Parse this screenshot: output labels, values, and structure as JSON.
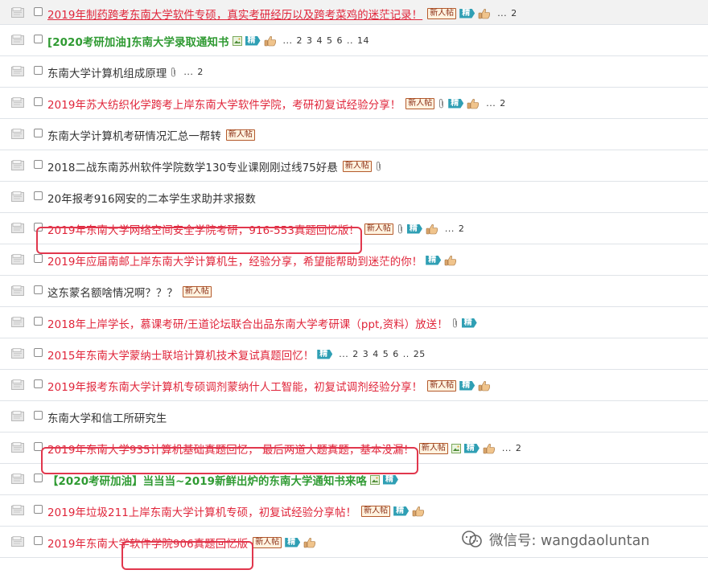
{
  "threads": [
    {
      "title": "2019年制药跨考东南大学软件专硕，真实考研经历以及跨考菜鸡的迷茫记录！",
      "style": "red-ul",
      "badges": [
        "new",
        "jing",
        "thumb"
      ],
      "pages": [
        "...",
        "2"
      ]
    },
    {
      "title": "[2020考研加油]东南大学录取通知书",
      "style": "green",
      "badges": [
        "img",
        "jing",
        "thumb"
      ],
      "pages": [
        "...",
        "2",
        "3",
        "4",
        "5",
        "6",
        "..",
        "14"
      ]
    },
    {
      "title": "东南大学计算机组成原理",
      "style": "normal",
      "badges": [
        "clip"
      ],
      "pages": [
        "...",
        "2"
      ]
    },
    {
      "title": "2019年苏大纺织化学跨考上岸东南大学软件学院，考研初复试经验分享！",
      "style": "red",
      "badges": [
        "new",
        "clip",
        "jing",
        "thumb"
      ],
      "pages": [
        "...",
        "2"
      ]
    },
    {
      "title": "东南大学计算机考研情况汇总一帮转",
      "style": "normal",
      "badges": [
        "new"
      ],
      "pages": []
    },
    {
      "title": "2018二战东南苏州软件学院数学130专业课刚刚过线75好悬",
      "style": "normal",
      "badges": [
        "new",
        "clip"
      ],
      "pages": []
    },
    {
      "title": "20年报考916网安的二本学生求助并求报数",
      "style": "normal",
      "badges": [],
      "pages": []
    },
    {
      "title": "2019年东南大学网络空间安全学院考研，916-553真题回忆版！",
      "style": "red",
      "badges": [
        "new",
        "clip",
        "jing",
        "thumb"
      ],
      "pages": [
        "...",
        "2"
      ]
    },
    {
      "title": "2019年应届南邮上岸东南大学计算机生，经验分享，希望能帮助到迷茫的你！",
      "style": "red",
      "badges": [
        "jing",
        "thumb"
      ],
      "pages": []
    },
    {
      "title": "这东蒙名额啥情况啊？？？",
      "style": "normal",
      "badges": [
        "new"
      ],
      "pages": []
    },
    {
      "title": "2018年上岸学长，慕课考研/王道论坛联合出品东南大学考研课（ppt,资料）放送！",
      "style": "red",
      "badges": [
        "clip",
        "jing"
      ],
      "pages": []
    },
    {
      "title": "2015年东南大学蒙纳士联培计算机技术复试真题回忆！",
      "style": "red",
      "badges": [
        "jing"
      ],
      "pages": [
        "...",
        "2",
        "3",
        "4",
        "5",
        "6",
        "..",
        "25"
      ]
    },
    {
      "title": "2019年报考东南大学计算机专硕调剂蒙纳什人工智能，初复试调剂经验分享！",
      "style": "red",
      "badges": [
        "new",
        "jing",
        "thumb"
      ],
      "pages": []
    },
    {
      "title": "东南大学和信工所研究生",
      "style": "normal",
      "badges": [],
      "pages": []
    },
    {
      "title": "2019年东南大学935计算机基础真题回忆， 最后两道大题真题，基本没漏！",
      "style": "red",
      "badges": [
        "new",
        "img",
        "jing",
        "thumb"
      ],
      "pages": [
        "...",
        "2"
      ]
    },
    {
      "title": "【2020考研加油】当当当~2019新鲜出炉的东南大学通知书来咯",
      "style": "green",
      "badges": [
        "img",
        "jing"
      ],
      "pages": []
    },
    {
      "title": "2019年垃圾211上岸东南大学计算机专硕，初复试经验分享帖！",
      "style": "red",
      "badges": [
        "new",
        "jing",
        "thumb"
      ],
      "pages": []
    },
    {
      "title": "2019年东南大学软件学院906真题回忆版",
      "style": "red",
      "badges": [
        "new",
        "jing",
        "thumb"
      ],
      "pages": []
    }
  ],
  "badge_labels": {
    "new": "新人帖",
    "jing": "精"
  },
  "watermark": {
    "text": "微信号: wangdaoluntan"
  },
  "colors": {
    "red_title": "#e0253a",
    "green_title": "#2f9a32",
    "highlight": "#e1374d",
    "jing_badge": "#2f9fb4"
  }
}
